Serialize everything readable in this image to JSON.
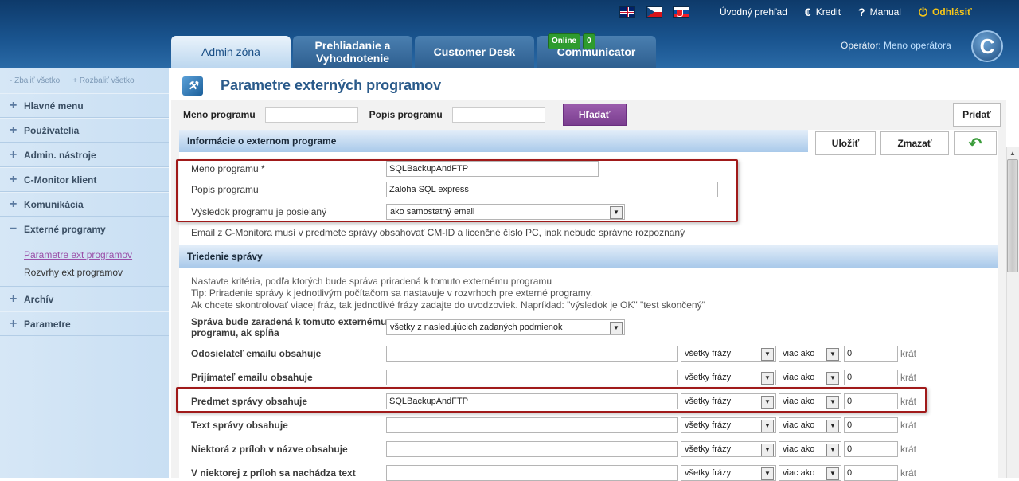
{
  "header": {
    "topnav": {
      "languages": [
        "EN",
        "CZ",
        "SK"
      ],
      "home_label": "Úvodný prehľad",
      "credit_label": "Kredit",
      "manual_label": "Manual",
      "logout_label": "Odhlásiť"
    },
    "tabs": [
      {
        "label": "Admin zóna"
      },
      {
        "label": "Prehliadanie a Vyhodnotenie"
      },
      {
        "label": "Customer Desk"
      },
      {
        "label": "Communicator"
      }
    ],
    "online_badge": {
      "label": "Online",
      "count": "0"
    },
    "operator_prefix": "Operátor:",
    "operator_name": "Meno operátora",
    "logo_letter": "C"
  },
  "sidebar": {
    "collapse_all": "- Zbaliť všetko",
    "expand_all": "+ Rozbaliť všetko",
    "items": [
      {
        "label": "Hlavné menu",
        "sign": "+"
      },
      {
        "label": "Používatelia",
        "sign": "+"
      },
      {
        "label": "Admin. nástroje",
        "sign": "+"
      },
      {
        "label": "C-Monitor klient",
        "sign": "+"
      },
      {
        "label": "Komunikácia",
        "sign": "+"
      },
      {
        "label": "Externé programy",
        "sign": "−"
      },
      {
        "label": "Archív",
        "sign": "+"
      },
      {
        "label": "Parametre",
        "sign": "+"
      }
    ],
    "submenu": [
      {
        "label": "Parametre ext programov"
      },
      {
        "label": "Rozvrhy ext programov"
      }
    ]
  },
  "page": {
    "title": "Parametre externých programov",
    "filter": {
      "name_label": "Meno programu",
      "desc_label": "Popis programu",
      "search_label": "Hľadať",
      "add_label": "Pridať"
    },
    "actions": {
      "save_label": "Uložiť",
      "delete_label": "Zmazať"
    },
    "info_section": {
      "title": "Informácie o externom programe",
      "name_label": "Meno programu *",
      "name_value": "SQLBackupAndFTP",
      "desc_label": "Popis programu",
      "desc_value": "Zaloha SQL express",
      "result_label": "Výsledok programu je posielaný",
      "result_value": "ako samostatný email",
      "note": "Email z C-Monitora musí v predmete správy obsahovať CM-ID a licenčné číslo PC, inak nebude správne rozpoznaný"
    },
    "sort_section": {
      "title": "Triedenie správy",
      "help1": "Nastavte kritéria, podľa ktorých bude správa priradená k tomuto externému programu",
      "help2": "Tip: Priradenie správy k jednotlivým počítačom sa nastavuje v rozvrhoch pre externé programy.",
      "help3": "Ak chcete skontrolovať viacej fráz, tak jednotlivé frázy zadajte do uvodzoviek. Napríklad: \"výsledok je OK\" \"test skončený\"",
      "condition_label_1": "Správa bude zaradená k tomuto externému",
      "condition_label_2": "programu, ak spĺňa",
      "condition_value": "všetky z nasledujúcich zadaných podmienok",
      "rows": [
        {
          "label": "Odosielateľ emailu obsahuje",
          "value": "",
          "phrases": "všetky frázy",
          "cmp": "viac ako",
          "count": "0",
          "unit": "krát"
        },
        {
          "label": "Prijímateľ emailu obsahuje",
          "value": "",
          "phrases": "všetky frázy",
          "cmp": "viac ako",
          "count": "0",
          "unit": "krát"
        },
        {
          "label": "Predmet správy obsahuje",
          "value": "SQLBackupAndFTP",
          "phrases": "všetky frázy",
          "cmp": "viac ako",
          "count": "0",
          "unit": "krát"
        },
        {
          "label": "Text správy obsahuje",
          "value": "",
          "phrases": "všetky frázy",
          "cmp": "viac ako",
          "count": "0",
          "unit": "krát"
        },
        {
          "label": "Niektorá z príloh v názve obsahuje",
          "value": "",
          "phrases": "všetky frázy",
          "cmp": "viac ako",
          "count": "0",
          "unit": "krát"
        },
        {
          "label": "V niektorej z príloh sa nachádza text",
          "value": "",
          "phrases": "všetky frázy",
          "cmp": "viac ako",
          "count": "0",
          "unit": "krát"
        }
      ]
    }
  }
}
